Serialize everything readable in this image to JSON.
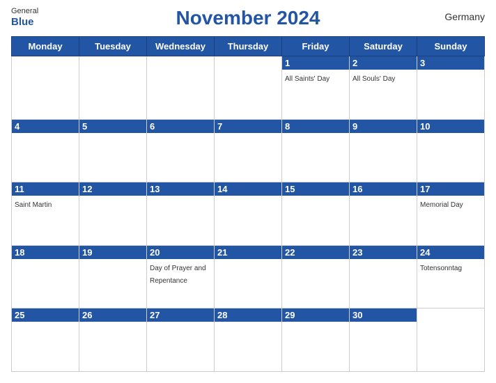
{
  "header": {
    "title": "November 2024",
    "country": "Germany",
    "logo": {
      "line1": "General",
      "line2": "Blue"
    }
  },
  "weekdays": [
    "Monday",
    "Tuesday",
    "Wednesday",
    "Thursday",
    "Friday",
    "Saturday",
    "Sunday"
  ],
  "weeks": [
    [
      {
        "day": "",
        "holiday": ""
      },
      {
        "day": "",
        "holiday": ""
      },
      {
        "day": "",
        "holiday": ""
      },
      {
        "day": "",
        "holiday": ""
      },
      {
        "day": "1",
        "holiday": "All Saints' Day"
      },
      {
        "day": "2",
        "holiday": "All Souls' Day"
      },
      {
        "day": "3",
        "holiday": ""
      }
    ],
    [
      {
        "day": "4",
        "holiday": ""
      },
      {
        "day": "5",
        "holiday": ""
      },
      {
        "day": "6",
        "holiday": ""
      },
      {
        "day": "7",
        "holiday": ""
      },
      {
        "day": "8",
        "holiday": ""
      },
      {
        "day": "9",
        "holiday": ""
      },
      {
        "day": "10",
        "holiday": ""
      }
    ],
    [
      {
        "day": "11",
        "holiday": "Saint Martin"
      },
      {
        "day": "12",
        "holiday": ""
      },
      {
        "day": "13",
        "holiday": ""
      },
      {
        "day": "14",
        "holiday": ""
      },
      {
        "day": "15",
        "holiday": ""
      },
      {
        "day": "16",
        "holiday": ""
      },
      {
        "day": "17",
        "holiday": "Memorial Day"
      }
    ],
    [
      {
        "day": "18",
        "holiday": ""
      },
      {
        "day": "19",
        "holiday": ""
      },
      {
        "day": "20",
        "holiday": "Day of Prayer and Repentance"
      },
      {
        "day": "21",
        "holiday": ""
      },
      {
        "day": "22",
        "holiday": ""
      },
      {
        "day": "23",
        "holiday": ""
      },
      {
        "day": "24",
        "holiday": "Totensonntag"
      }
    ],
    [
      {
        "day": "25",
        "holiday": ""
      },
      {
        "day": "26",
        "holiday": ""
      },
      {
        "day": "27",
        "holiday": ""
      },
      {
        "day": "28",
        "holiday": ""
      },
      {
        "day": "29",
        "holiday": ""
      },
      {
        "day": "30",
        "holiday": ""
      },
      {
        "day": "",
        "holiday": ""
      }
    ]
  ]
}
